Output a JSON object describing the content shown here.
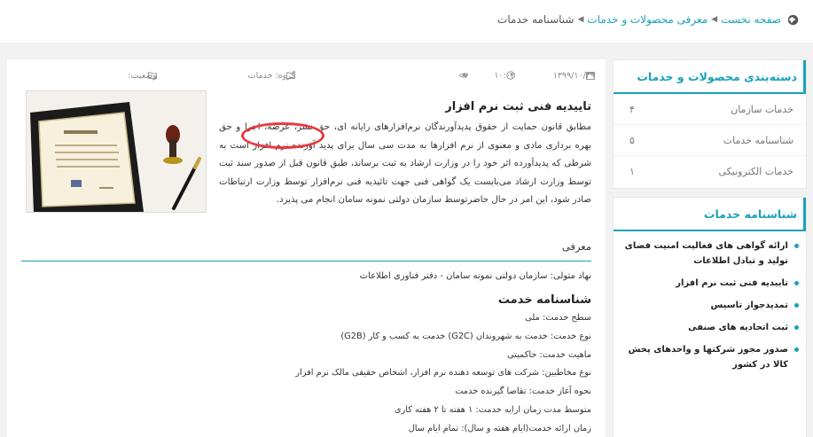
{
  "breadcrumb": {
    "home": "صفحه نخست",
    "parent": "معرفی محصولات و خدمات",
    "current": "شناسنامه خدمات"
  },
  "categories": {
    "title": "دسته‌بندی محصولات و خدمات",
    "items": [
      {
        "label": "خدمات سازمان",
        "count": "۴"
      },
      {
        "label": "شناسنامه خدمات",
        "count": "۵"
      },
      {
        "label": "خدمات الکترونیکی",
        "count": "۱"
      }
    ]
  },
  "services": {
    "title": "شناسنامه خدمات",
    "items": [
      "ارائه گواهی های فعالیت امنیت فضای تولید و تبادل اطلاعات",
      "تاییدیه فنی ثبت نرم افزار",
      "تمدیدجواز تاسیس",
      "ثبت اتحادیه های صنفی",
      "صدور مجوز شرکتها و واحدهای پخش کالا در کشور"
    ]
  },
  "meta": {
    "date": "۱۳۹۹/۱۰/۲۹",
    "time": "۱۰:۰۲",
    "views": "۷",
    "group": "گروه: خدمات",
    "status": "وضعیت:"
  },
  "article": {
    "title": "تاییدیه فنی ثبت نرم افزار",
    "body": "مطابق قانون حمایت از حقوق پدیدآورندگان نرم‌افزارهای رایانه ای، حق نشر، عرضه، اجرا و حق بهره برداری مادی و معنوی از نرم افزارها به مدت سی سال برای پدید آورنده نرم افزار است به شرطی که پدیدآورده اثر خود را در وزارت ارشاد به ثبت برساند، طبق قانون قبل از صدور سند ثبت توسط وزارت ارشاد می‌بایست یک گواهی فنی جهت تائیدیه فنی نرم‌افزار توسط وزارت ارتباطات صادر شود، این امر در حال حاضرتوسط سازمان دولتی نمونه سامان انجام می پذیرد.",
    "section": "معرفی",
    "owner": "نهاد متولی: سازمان دولتی نمونه سامان - دفتر فناوری اطلاعات",
    "sub_title": "شناسنامه خدمت",
    "details": [
      "سطح خدمت: ملی",
      "نوع خدمت: خدمت به شهروندان (G2C) خدمت به کسب و کار (G2B)",
      "ماهیت خدمت: حاکمیتی",
      "نوع مخاطبین: شرکت های توسعه دهنده نرم افزار، اشخاص حقیقی مالک نرم افزار",
      "نحوه آغاز خدمت: تقاضا گیرنده خدمت",
      "متوسط مدت زمان ارایه خدمت: ۱ هفته تا ۲ هفته کاری",
      "زمان ارائه خدمت(ایام هفته و سال): تمام ایام سال"
    ]
  },
  "colors": {
    "accent": "#1aa3b8",
    "highlight": "#e8393f"
  }
}
